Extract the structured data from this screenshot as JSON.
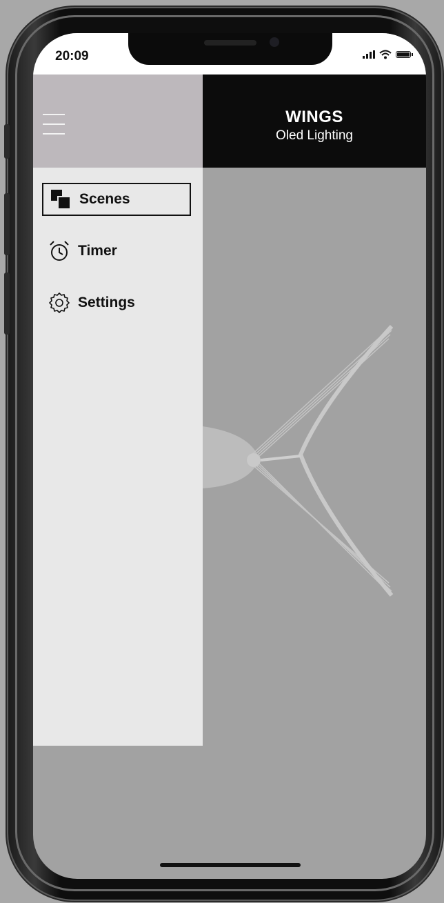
{
  "status_bar": {
    "time": "20:09"
  },
  "header": {
    "title": "WINGS",
    "subtitle": "Oled Lighting"
  },
  "drawer": {
    "items": [
      {
        "label": "Scenes",
        "icon": "scenes-icon",
        "active": true
      },
      {
        "label": "Timer",
        "icon": "alarm-clock-icon",
        "active": false
      },
      {
        "label": "Settings",
        "icon": "gear-icon",
        "active": false
      }
    ]
  },
  "colors": {
    "header_dark": "#0c0c0c",
    "header_light": "#bdb8bc",
    "drawer_bg": "#e8e8e8",
    "content_bg": "#a2a2a2"
  }
}
